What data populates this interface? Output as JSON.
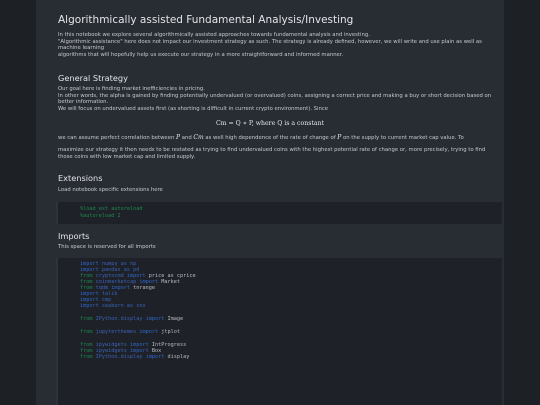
{
  "notebook": {
    "title": "Algorithmically assisted Fundamental Analysis/Investing",
    "intro": [
      "In this notebook we explore several algorithmically assisted approaches towards fundamental analysis and investing.",
      "\"Algorithmic assistance\" here does not impact our investment strategy as such. The strategy is already defined, however, we will write and use plain as well as",
      "machine learning",
      "algorithms that will hopefully help us execute our strategy in a more straightforward and informed manner."
    ],
    "general_strategy": {
      "heading": "General Strategy",
      "lines": [
        "Our goal here is finding market inefficiencies in pricing.",
        "In other words, the alpha is gained by finding potentially undervalued (or overvalued) coins, assigning a correct price and making a buy or short decision based on",
        "better information.",
        "We will focus on undervalued assets first (as shorting is difficult in current crypto environment). Since"
      ],
      "formula": "Cm = Q ∗ P, where Q is a constant",
      "corr_before": "we can assume perfect correlation between ",
      "corr_p": "P",
      "corr_mid": " and ",
      "corr_cm": "Cm",
      "corr_mid2": " as well high dependence of the rate of change of ",
      "corr_p2": "P",
      "corr_after": " on the supply to current market cap value. To",
      "closing": [
        "maximize our strategy it then needs to be restated as trying to find undervalued coins with the highest potential rate of change or, more precisely, trying to find",
        "those coins with low market cap and limited supply."
      ]
    },
    "extensions": {
      "heading": "Extensions",
      "text": "Load notebook specific extensions here",
      "code": [
        "%load_ext autoreload",
        "%autoreload 2"
      ]
    },
    "imports": {
      "heading": "Imports",
      "text": "This space is reserved for all imports",
      "code": [
        {
          "k1": "import",
          "m1": "numpy",
          "k2": "as",
          "m2": "np",
          "rest": ""
        },
        {
          "k1": "import",
          "m1": "pandas",
          "k2": "as",
          "m2": "pd",
          "rest": ""
        },
        {
          "k1": "from",
          "m1": "cryptocmd",
          "k2": "import",
          "m2": "",
          "rest": "price as cprice"
        },
        {
          "k1": "from",
          "m1": "coinmarketcap",
          "k2": "import",
          "m2": "",
          "rest": "Market"
        },
        {
          "k1": "from",
          "m1": "tqdm",
          "k2": "import",
          "m2": "",
          "rest": "tnrange"
        },
        {
          "k1": "import",
          "m1": "talib",
          "k2": "",
          "m2": "",
          "rest": ""
        },
        {
          "k1": "import",
          "m1": "cmp",
          "k2": "",
          "m2": "",
          "rest": ""
        },
        {
          "k1": "import",
          "m1": "seaborn",
          "k2": "as",
          "m2": "sns",
          "rest": ""
        },
        {
          "k1": "from",
          "m1": "IPython.display",
          "k2": "import",
          "m2": "",
          "rest": "Image"
        },
        {
          "k1": "from",
          "m1": "jupyterthemes",
          "k2": "import",
          "m2": "",
          "rest": "jtplot"
        },
        {
          "k1": "from",
          "m1": "ipywidgets",
          "k2": "import",
          "m2": "",
          "rest": "IntProgress"
        },
        {
          "k1": "from",
          "m1": "ipywidgets",
          "k2": "import",
          "m2": "",
          "rest": "Box"
        },
        {
          "k1": "from",
          "m1": "IPython.display",
          "k2": "import",
          "m2": "",
          "rest": "display"
        }
      ]
    }
  }
}
